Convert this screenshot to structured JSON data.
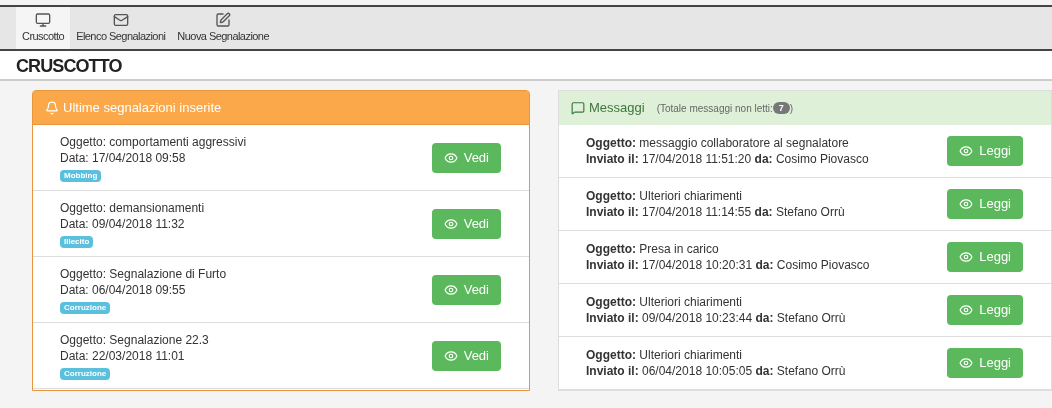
{
  "toolbar": [
    {
      "label": "Cruscotto",
      "kind": "monitor",
      "selected": true
    },
    {
      "label": "Elenco Segnalazioni",
      "kind": "mail",
      "selected": false
    },
    {
      "label": "Nuova Segnalazione",
      "kind": "edit",
      "selected": false
    }
  ],
  "page_title": "CRUSCOTTO",
  "reports_panel": {
    "title": "Ultime segnalazioni inserite",
    "items": [
      {
        "subject": "Oggetto: comportamenti aggressivi",
        "date": "Data: 17/04/2018 09:58",
        "tag": "Mobbing",
        "button": "Vedi"
      },
      {
        "subject": "Oggetto: demansionamenti",
        "date": "Data: 09/04/2018 11:32",
        "tag": "Illecito",
        "button": "Vedi"
      },
      {
        "subject": "Oggetto: Segnalazione di Furto",
        "date": "Data: 06/04/2018 09:55",
        "tag": "Corruzione",
        "button": "Vedi"
      },
      {
        "subject": "Oggetto: Segnalazione 22.3",
        "date": "Data: 22/03/2018 11:01",
        "tag": "Corruzione",
        "button": "Vedi"
      }
    ]
  },
  "messages_panel": {
    "title": "Messaggi",
    "unread_label": "(Totale messaggi non letti:",
    "unread_count": "7",
    "unread_close": ")",
    "items": [
      {
        "subject": "**Oggetto:** messaggio collaboratore al segnalatore",
        "sent": "**Inviato il:** 17/04/2018 11:51:20 **da:** Cosimo Piovasco",
        "button": "Leggi"
      },
      {
        "subject": "**Oggetto:** Ulteriori chiarimenti",
        "sent": "**Inviato il:** 17/04/2018 11:14:55 **da:** Stefano Orrù",
        "button": "Leggi"
      },
      {
        "subject": "**Oggetto:** Presa in carico",
        "sent": "**Inviato il:** 17/04/2018 10:20:31 **da:** Cosimo Piovasco",
        "button": "Leggi"
      },
      {
        "subject": "**Oggetto:** Ulteriori chiarimenti",
        "sent": "**Inviato il:** 09/04/2018 10:23:44 **da:** Stefano Orrù",
        "button": "Leggi"
      },
      {
        "subject": "**Oggetto:** Ulteriori chiarimenti",
        "sent": "**Inviato il:** 06/04/2018 10:05:05 **da:** Stefano Orrù",
        "button": "Leggi"
      }
    ]
  }
}
